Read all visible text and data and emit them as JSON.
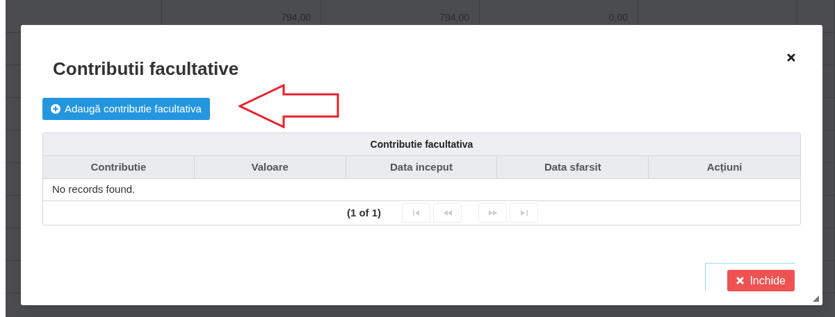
{
  "background_table": {
    "rows": [
      [
        "",
        "794,00",
        "794,00",
        "0,00",
        "",
        ""
      ],
      [
        "",
        "",
        "",
        "",
        "",
        ""
      ],
      [
        "",
        "",
        "",
        "",
        "",
        ""
      ],
      [
        "",
        "",
        "",
        "",
        "",
        ""
      ],
      [
        "",
        "",
        "",
        "",
        "",
        ""
      ],
      [
        "",
        "",
        "",
        "",
        "",
        ""
      ],
      [
        "",
        "",
        "",
        "",
        "",
        ""
      ],
      [
        "",
        "",
        "",
        "",
        "",
        ""
      ],
      [
        "",
        "",
        "",
        "",
        "",
        ""
      ]
    ]
  },
  "dialog": {
    "title": "Contributii facultative",
    "add_button": "Adaugă contributie facultativa",
    "table": {
      "caption": "Contributie facultativa",
      "columns": [
        "Contributie",
        "Valoare",
        "Data inceput",
        "Data sfarsit",
        "Acțiuni"
      ],
      "empty_message": "No records found."
    },
    "paginator": {
      "report": "(1 of 1)",
      "buttons": [
        {
          "kind": "first",
          "disabled": true
        },
        {
          "kind": "prev",
          "disabled": true
        },
        {
          "kind": "next",
          "disabled": true
        },
        {
          "kind": "last",
          "disabled": true
        }
      ]
    },
    "close_button": "Inchide"
  }
}
